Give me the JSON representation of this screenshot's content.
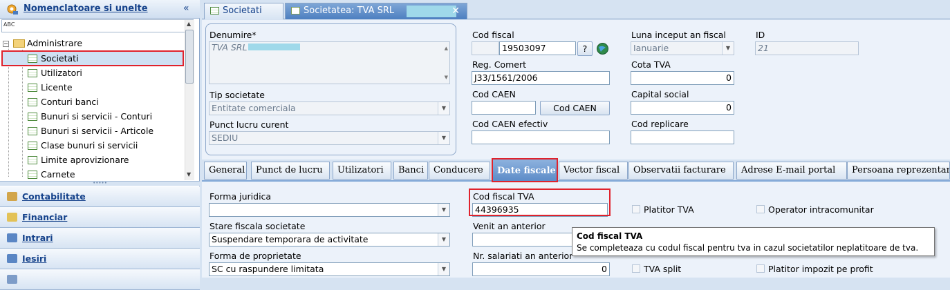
{
  "left_panel": {
    "title": "Nomenclatoare si unelte",
    "collapse_glyph": "«",
    "search_icon_text": "ABC",
    "tree": {
      "root": "Administrare",
      "items": [
        "Societati",
        "Utilizatori",
        "Licente",
        "Conturi banci",
        "Bunuri si servicii - Conturi",
        "Bunuri si servicii - Articole",
        "Clase bunuri si servicii",
        "Limite aprovizionare",
        "Carnete"
      ],
      "selected": "Societati"
    },
    "splitter_glyph": "•••••",
    "nav": [
      "Contabilitate",
      "Financiar",
      "Intrari",
      "Iesiri"
    ]
  },
  "tabs": {
    "societati": "Societati",
    "societatea": "Societatea: TVA SRL",
    "close_glyph": "✕"
  },
  "form": {
    "denumire_label": "Denumire*",
    "denumire_value": "TVA SRL",
    "tip_label": "Tip societate",
    "tip_value": "Entitate comerciala",
    "punct_label": "Punct lucru curent",
    "punct_value": "SEDIU",
    "cod_fiscal_label": "Cod fiscal",
    "cod_fiscal_value": "19503097",
    "help_button": "?",
    "reg_label": "Reg. Comert",
    "reg_value": "J33/1561/2006",
    "caen_label": "Cod CAEN",
    "caen_value": "",
    "caen_button": "Cod CAEN",
    "caen_ef_label": "Cod CAEN efectiv",
    "caen_ef_value": "",
    "luna_label": "Luna inceput an fiscal",
    "luna_value": "Ianuarie",
    "id_label": "ID",
    "id_value": "21",
    "cota_label": "Cota TVA",
    "cota_value": "0",
    "capital_label": "Capital social",
    "capital_value": "0",
    "replicare_label": "Cod replicare",
    "replicare_value": ""
  },
  "subtabs": [
    "General",
    "Punct de lucru",
    "Utilizatori",
    "Banci",
    "Conducere",
    "Date fiscale",
    "Vector fiscal",
    "Observatii facturare",
    "Adrese E-mail portal",
    "Persoana reprezentare"
  ],
  "active_subtab": "Date fiscale",
  "fiscal": {
    "forma_label": "Forma juridica",
    "forma_value": "",
    "stare_label": "Stare fiscala societate",
    "stare_value": "Suspendare temporara de activitate",
    "proprietate_label": "Forma de proprietate",
    "proprietate_value": "SC cu raspundere limitata",
    "cf_tva_label": "Cod fiscal TVA",
    "cf_tva_value": "44396935",
    "venit_label": "Venit an anterior",
    "venit_value": "",
    "salariati_label": "Nr. salariati an anterior",
    "salariati_value": "0",
    "platitor_tva": "Platitor TVA",
    "operator": "Operator intracomunitar",
    "tva_split": "TVA split",
    "platitor_impozit": "Platitor impozit pe profit"
  },
  "tooltip": {
    "title": "Cod fiscal TVA",
    "text": "Se completeaza cu codul fiscal pentru tva in cazul societatilor neplatitoare de tva."
  }
}
